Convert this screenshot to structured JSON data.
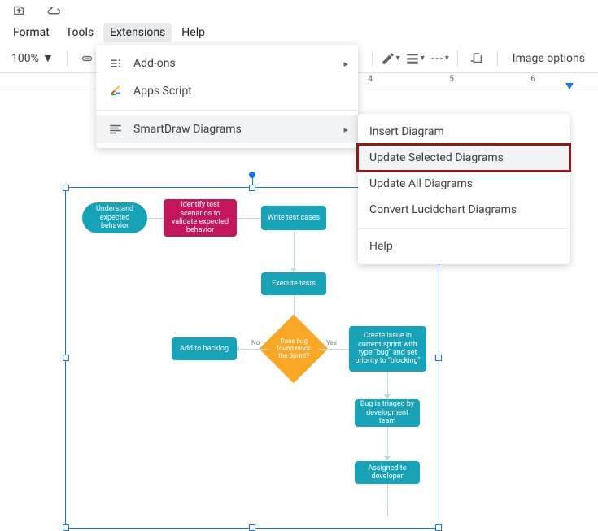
{
  "menubar": {
    "format": "Format",
    "tools": "Tools",
    "extensions": "Extensions",
    "help": "Help"
  },
  "toolbar": {
    "zoom": "100%",
    "image_options": "Image options"
  },
  "ruler": {
    "n4": "4",
    "n5": "5",
    "n6": "6"
  },
  "ext_menu": {
    "addons": "Add-ons",
    "apps_script": "Apps Script",
    "smartdraw": "SmartDraw Diagrams"
  },
  "sd_menu": {
    "insert": "Insert Diagram",
    "update_selected": "Update Selected Diagrams",
    "update_all": "Update All Diagrams",
    "convert": "Convert Lucidchart Diagrams",
    "help": "Help"
  },
  "flow": {
    "understand": "Understand expected behavior",
    "identify": "Identify test scenarios to validate expected behavior",
    "write": "Write test cases",
    "execute": "Execute tests",
    "decision": "Does bug found block the Sprint?",
    "backlog": "Add to backlog",
    "create_issue": "Create issue in current sprint with type \"bug\" and set priority to \"blocking\"",
    "triaged": "Bug is triaged by development team",
    "assigned": "Assigned to developer",
    "no": "No",
    "yes": "Yes"
  }
}
